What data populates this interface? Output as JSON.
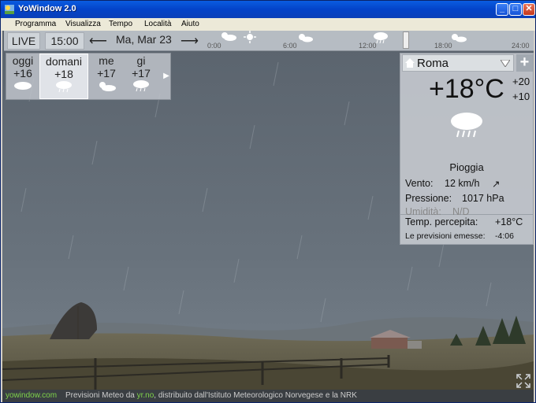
{
  "window": {
    "title": "YoWindow 2.0"
  },
  "menu": {
    "items": [
      "Programma",
      "Visualizza",
      "Tempo",
      "Località",
      "Aiuto"
    ]
  },
  "toolbar": {
    "live_label": "LIVE",
    "time": "15:00",
    "date": "Ma, Mar 23",
    "back_icon": "arrow-left-icon",
    "forward_icon": "arrow-right-icon"
  },
  "timeline": {
    "labels": [
      "0:00",
      "6:00",
      "12:00",
      "18:00",
      "24:00"
    ],
    "icons": [
      "partly-cloudy-icon",
      "sun-icon",
      "sun-icon",
      "rain-cloud-icon",
      "sun-icon"
    ]
  },
  "forecast": {
    "days": [
      {
        "name": "oggi",
        "temp": "+16",
        "icon": "cloud-icon"
      },
      {
        "name": "domani",
        "temp": "+18",
        "icon": "rain-cloud-icon"
      },
      {
        "name": "me",
        "temp": "+17",
        "icon": "partly-sunny-icon"
      },
      {
        "name": "gi",
        "temp": "+17",
        "icon": "rain-cloud-icon"
      }
    ],
    "more_icon": "triangle-right-icon"
  },
  "current": {
    "city": "Roma",
    "temperature": "+18°C",
    "high": "+20",
    "low": "+10",
    "condition": "Pioggia",
    "wind_label": "Vento:",
    "wind_value": "12 km/h",
    "wind_direction_icon": "arrow-up-right-icon",
    "pressure_label": "Pressione:",
    "pressure_value": "1017 hPa",
    "humidity_label": "Umidità:",
    "humidity_value": "N/D",
    "feels_label": "Temp. percepita:",
    "feels_value": "+18°C",
    "issued_label": "Le previsioni emesse:",
    "issued_value": "-4:06"
  },
  "status": {
    "site": "yowindow.com",
    "text_before": "Previsioni Meteo da ",
    "source": "yr.no",
    "text_after": ", distribuito dall'Istituto Meteorologico Norvegese e la NRK"
  },
  "colors": {
    "titlebar": "#0343c9",
    "sky": "#5c6672",
    "status_link": "#7fd44a"
  }
}
